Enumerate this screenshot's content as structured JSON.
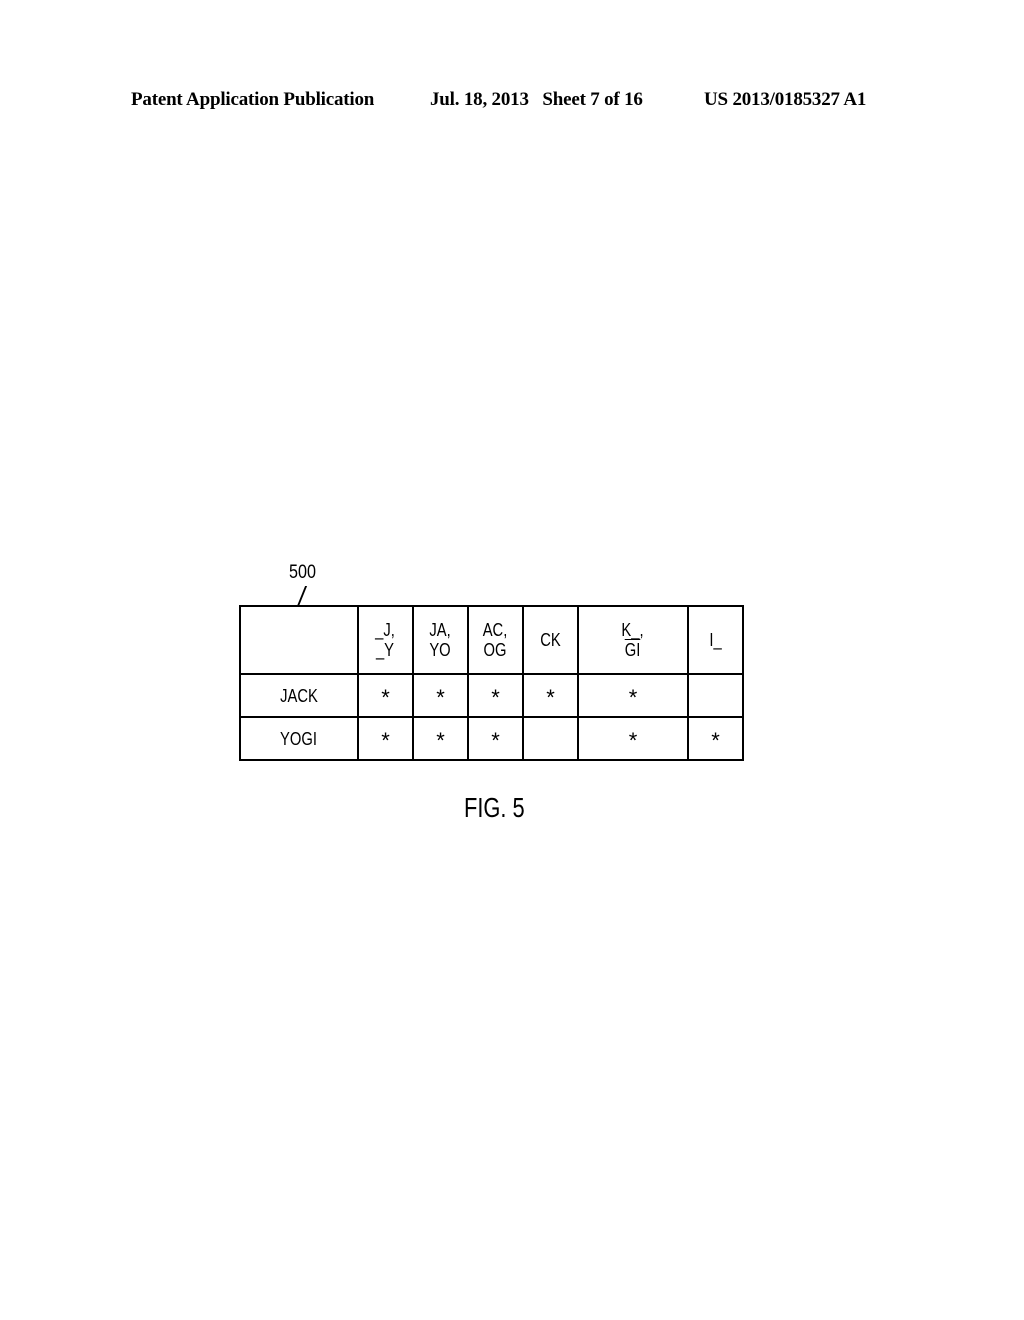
{
  "header": {
    "publication": "Patent Application Publication",
    "date_sheet": "Jul. 18, 2013   Sheet 7 of 16",
    "patent_number": "US 2013/0185327 A1"
  },
  "figure": {
    "reference_numeral": "500",
    "caption": "FIG. 5",
    "table": {
      "column_headers": [
        {
          "line1": "",
          "line2": ""
        },
        {
          "line1": "_J,",
          "line2": "_Y"
        },
        {
          "line1": "JA,",
          "line2": "YO"
        },
        {
          "line1": "AC,",
          "line2": "OG"
        },
        {
          "line1": "CK",
          "line2": ""
        },
        {
          "line1": "K_,",
          "line2": "GI"
        },
        {
          "line1": "I_",
          "line2": ""
        }
      ],
      "rows": [
        {
          "label": "JACK",
          "cells": [
            "*",
            "*",
            "*",
            "*",
            "*",
            ""
          ]
        },
        {
          "label": "YOGI",
          "cells": [
            "*",
            "*",
            "*",
            "",
            "*",
            "*"
          ]
        }
      ]
    }
  }
}
